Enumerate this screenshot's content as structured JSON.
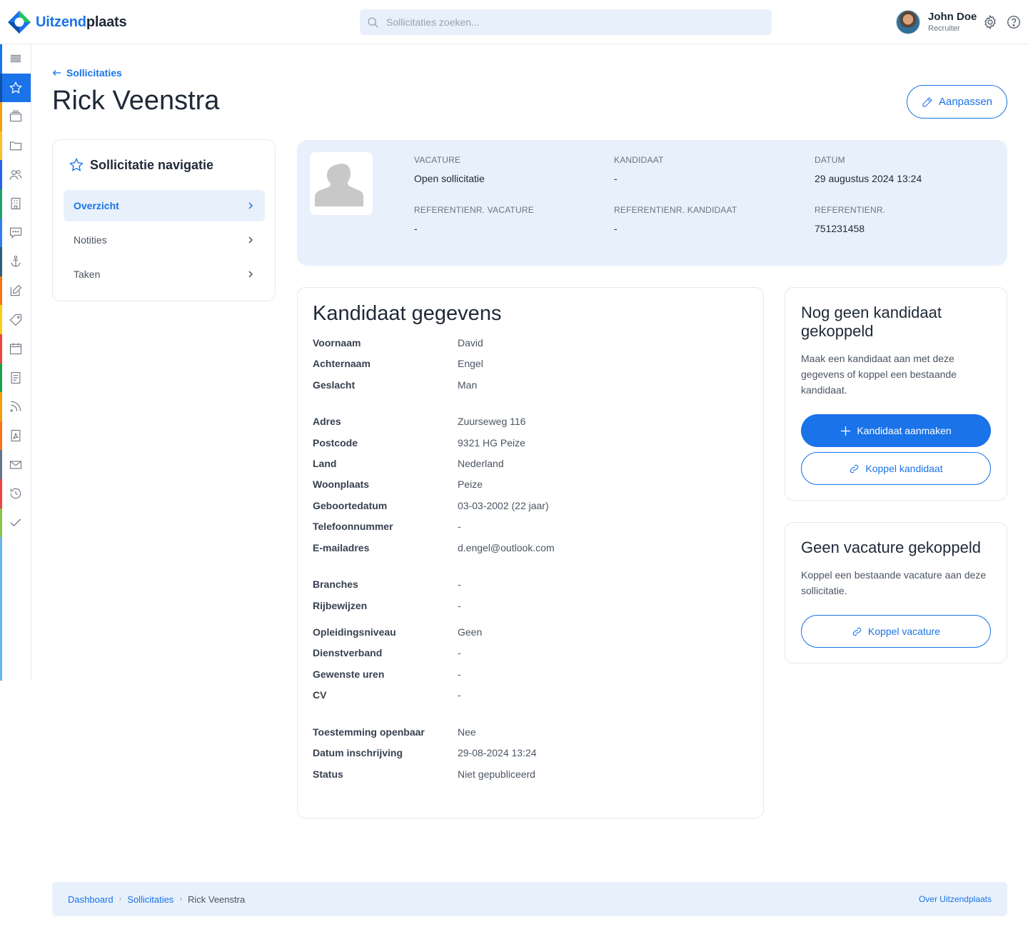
{
  "header": {
    "logo_part1": "Uitzend",
    "logo_part2": "plaats",
    "search_placeholder": "Sollicitaties zoeken...",
    "user_name": "John Doe",
    "user_role": "Recruiter"
  },
  "sidebar": {
    "items": [
      {
        "icon": "menu-icon",
        "color": "#1a73e8"
      },
      {
        "icon": "star-icon",
        "color": "#0f4fa8",
        "active": true
      },
      {
        "icon": "layers-icon",
        "color": "#f59e0b"
      },
      {
        "icon": "folder-icon",
        "color": "#fbbf24"
      },
      {
        "icon": "users-icon",
        "color": "#2563eb"
      },
      {
        "icon": "building-icon",
        "color": "#22a06b"
      },
      {
        "icon": "chat-icon",
        "color": "#2f80ed"
      },
      {
        "icon": "anchor-icon",
        "color": "#2b5f7a"
      },
      {
        "icon": "edit-icon",
        "color": "#f97316"
      },
      {
        "icon": "tag-icon",
        "color": "#facc15"
      },
      {
        "icon": "calendar-icon",
        "color": "#ef4444"
      },
      {
        "icon": "document-icon",
        "color": "#16a34a"
      },
      {
        "icon": "rss-icon",
        "color": "#f59e0b"
      },
      {
        "icon": "pdf-icon",
        "color": "#f97316"
      },
      {
        "icon": "mail-icon",
        "color": "#64748b"
      },
      {
        "icon": "history-icon",
        "color": "#ef4444"
      },
      {
        "icon": "check-icon",
        "color": "#8bc34a"
      }
    ]
  },
  "page": {
    "back_label": "Sollicitaties",
    "title": "Rick Veenstra",
    "edit_label": "Aanpassen"
  },
  "nav": {
    "title": "Sollicitatie navigatie",
    "items": [
      {
        "label": "Overzicht",
        "active": true
      },
      {
        "label": "Notities"
      },
      {
        "label": "Taken"
      }
    ]
  },
  "summary": {
    "vacature_label": "VACATURE",
    "vacature_value": "Open sollicitatie",
    "kandidaat_label": "KANDIDAAT",
    "kandidaat_value": "-",
    "datum_label": "DATUM",
    "datum_value": "29 augustus 2024 13:24",
    "ref_vac_label": "REFERENTIENR. VACATURE",
    "ref_vac_value": "-",
    "ref_kand_label": "REFERENTIENR. KANDIDAAT",
    "ref_kand_value": "-",
    "ref_label": "REFERENTIENR.",
    "ref_value": "751231458"
  },
  "candidate": {
    "title": "Kandidaat gegevens",
    "fields": [
      {
        "key": "Voornaam",
        "value": "David"
      },
      {
        "key": "Achternaam",
        "value": "Engel"
      },
      {
        "key": "Geslacht",
        "value": "Man"
      },
      {
        "key": "Adres",
        "value": "Zuurseweg 116"
      },
      {
        "key": "Postcode",
        "value": "9321 HG Peize"
      },
      {
        "key": "Land",
        "value": "Nederland"
      },
      {
        "key": "Woonplaats",
        "value": "Peize"
      },
      {
        "key": "Geboortedatum",
        "value": "03-03-2002 (22 jaar)"
      },
      {
        "key": "Telefoonnummer",
        "value": "-"
      },
      {
        "key": "E-mailadres",
        "value": "d.engel@outlook.com"
      },
      {
        "key": "Branches",
        "value": "-"
      },
      {
        "key": "Rijbewijzen",
        "value": "-"
      },
      {
        "key": "Opleidingsniveau",
        "value": "Geen"
      },
      {
        "key": "Dienstverband",
        "value": "-"
      },
      {
        "key": "Gewenste uren",
        "value": "-"
      },
      {
        "key": "CV",
        "value": "-"
      },
      {
        "key": "Toestemming openbaar",
        "value": "Nee"
      },
      {
        "key": "Datum inschrijving",
        "value": "29-08-2024 13:24"
      },
      {
        "key": "Status",
        "value": "Niet gepubliceerd"
      }
    ]
  },
  "no_candidate": {
    "title": "Nog geen kandidaat gekoppeld",
    "text": "Maak een kandidaat aan met deze gegevens of koppel een bestaande kandidaat.",
    "create_label": "Kandidaat aanmaken",
    "link_label": "Koppel kandidaat"
  },
  "no_vacancy": {
    "title": "Geen vacature gekoppeld",
    "text": "Koppel een bestaande vacature aan deze sollicitatie.",
    "link_label": "Koppel vacature"
  },
  "footer": {
    "crumb1": "Dashboard",
    "crumb2": "Sollicitaties",
    "crumb3": "Rick Veenstra",
    "about": "Over Uitzendplaats"
  },
  "colors": {
    "accent": "#1a73e8",
    "soft_blue": "#e8f1fb"
  }
}
